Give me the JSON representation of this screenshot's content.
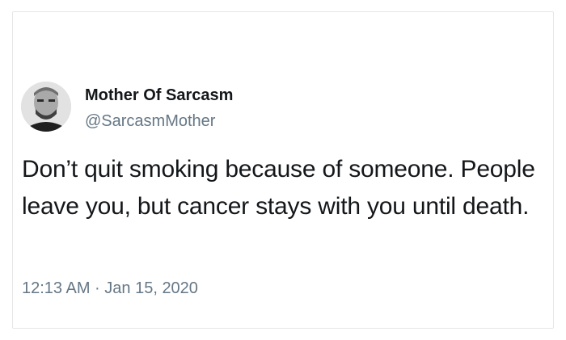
{
  "author": {
    "display_name": "Mother Of Sarcasm",
    "handle": "@SarcasmMother",
    "avatar_icon": "portrait-avatar-icon"
  },
  "tweet": {
    "text": "Don’t quit smoking because of someone. People leave you, but cancer stays with you until death.",
    "timestamp": "12:13 AM · Jan 15, 2020"
  },
  "colors": {
    "primary_text": "#14171a",
    "secondary_text": "#657786",
    "border": "#e6e6e6",
    "background": "#ffffff"
  }
}
